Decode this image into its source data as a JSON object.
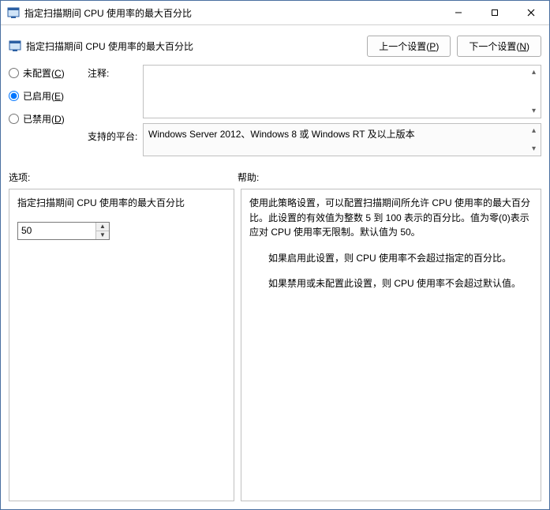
{
  "window": {
    "title": "指定扫描期间 CPU 使用率的最大百分比"
  },
  "header": {
    "title": "指定扫描期间 CPU 使用率的最大百分比",
    "prev_btn_label": "上一个设置",
    "prev_btn_key": "P",
    "next_btn_label": "下一个设置",
    "next_btn_key": "N"
  },
  "radios": {
    "not_configured_label": "未配置",
    "not_configured_key": "C",
    "enabled_label": "已启用",
    "enabled_key": "E",
    "disabled_label": "已禁用",
    "disabled_key": "D",
    "selected": "enabled"
  },
  "labels": {
    "comment": "注释:",
    "platform": "支持的平台:",
    "options": "选项:",
    "help": "帮助:"
  },
  "comment_text": "",
  "platform_text": "Windows Server 2012、Windows 8 或 Windows RT 及以上版本",
  "options": {
    "field_label": "指定扫描期间 CPU 使用率的最大百分比",
    "value": "50"
  },
  "help_paragraphs": [
    "使用此策略设置，可以配置扫描期间所允许 CPU 使用率的最大百分比。此设置的有效值为整数 5 到 100 表示的百分比。值为零(0)表示应对 CPU 使用率无限制。默认值为 50。",
    "如果启用此设置，则 CPU 使用率不会超过指定的百分比。",
    "如果禁用或未配置此设置，则 CPU 使用率不会超过默认值。"
  ]
}
